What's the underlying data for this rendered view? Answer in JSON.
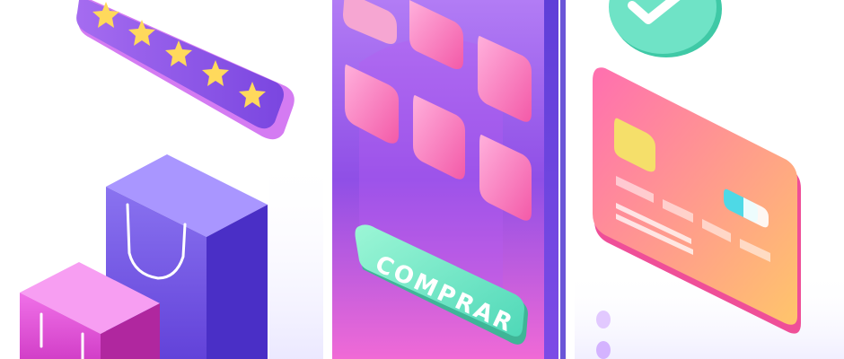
{
  "buy_button": {
    "label": "COMPRAR"
  },
  "rating": {
    "stars": 5,
    "max": 5
  },
  "colors": {
    "purple": "#7b4fe0",
    "magenta": "#e94fd1",
    "pink": "#ff6fb0",
    "mint": "#5fe3c0",
    "indigo": "#4b35c9",
    "orange": "#ffb36b",
    "star": "#ffd95c"
  },
  "icons": {
    "check": "check-icon",
    "star": "star-icon",
    "chip": "card-chip-icon",
    "bag": "shopping-bag-icon"
  }
}
